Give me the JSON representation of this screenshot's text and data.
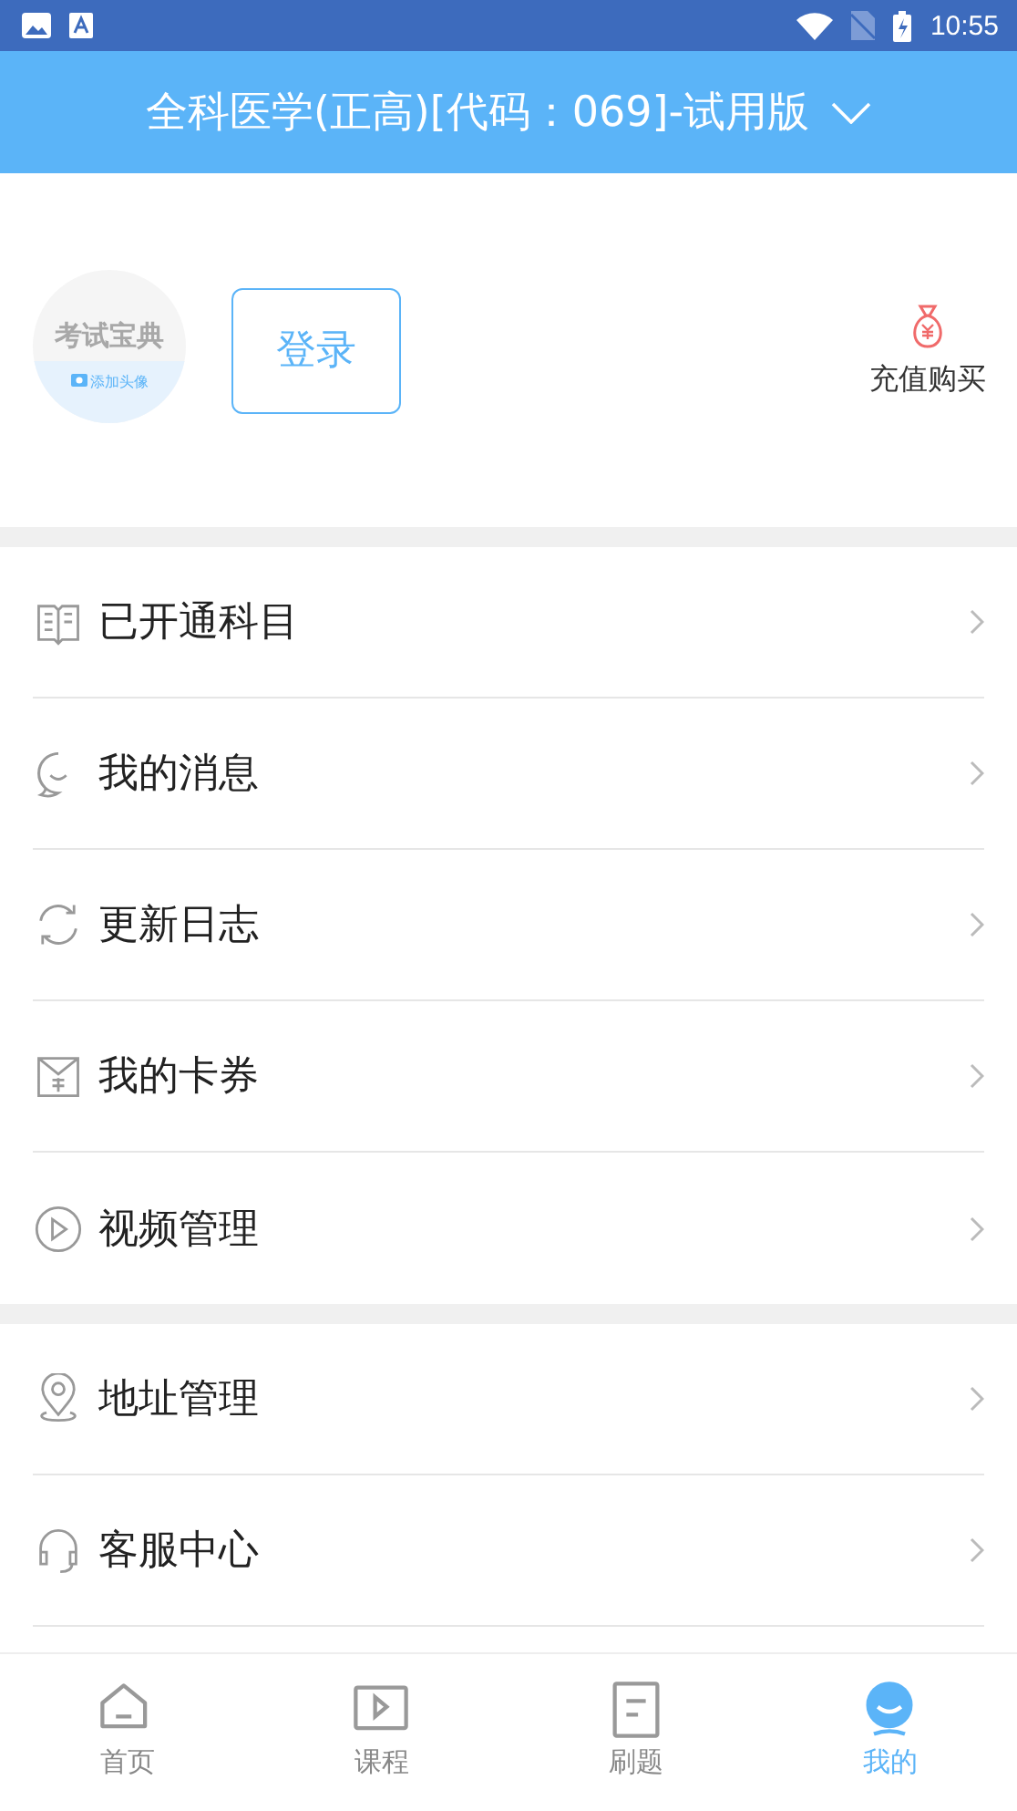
{
  "status_bar": {
    "time": "10:55"
  },
  "header": {
    "title": "全科医学(正高)[代码：069]-试用版"
  },
  "profile": {
    "avatar_title": "考试宝典",
    "avatar_action": "添加头像",
    "login": "登录",
    "recharge": "充值购买"
  },
  "menu_groups": [
    [
      {
        "label": "已开通科目"
      },
      {
        "label": "我的消息"
      },
      {
        "label": "更新日志"
      },
      {
        "label": "我的卡券"
      },
      {
        "label": "视频管理"
      }
    ],
    [
      {
        "label": "地址管理"
      },
      {
        "label": "客服中心"
      }
    ]
  ],
  "tabs": [
    {
      "label": "首页",
      "selected": false
    },
    {
      "label": "课程",
      "selected": false
    },
    {
      "label": "刷题",
      "selected": false
    },
    {
      "label": "我的",
      "selected": true
    }
  ]
}
